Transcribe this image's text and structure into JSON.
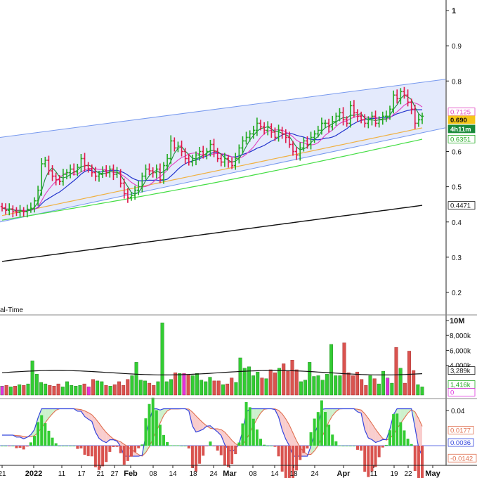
{
  "colors": {
    "up": "#22aa22",
    "down": "#e0184a",
    "volume_up": "#33cc33",
    "volume_down": "#d9534f",
    "volume_magenta": "#e030e0",
    "channel_fill": "#dfe6fb",
    "channel_line": "#7799ee",
    "ma_green": "#1a8a3a",
    "ma_magenta": "#e040c0",
    "ma_blue": "#2233cc",
    "ma_orange": "#f0b040",
    "ma_lightgreen": "#44dd44",
    "ma_black": "#111111",
    "macd_line": "#3344dd",
    "signal_line": "#e07050"
  },
  "chart_data": [
    {
      "type": "candlestick",
      "panel": "price",
      "title": "",
      "y_ticks": [
        "1",
        "0.9",
        "0.8",
        "0.6",
        "0.5",
        "0.4",
        "0.3",
        "0.2"
      ],
      "ylim": [
        0.15,
        1.02
      ],
      "last_close": 0.69,
      "price_tags": [
        {
          "label": "0.7125",
          "value": 0.7125,
          "color": "#e040c0"
        },
        {
          "label": "0.690",
          "value": 0.69,
          "color": "#111111",
          "bg": "#f5c518"
        },
        {
          "label": "4h11m",
          "value": 0.664,
          "color": "#ffffff",
          "bg": "#1a8a3a"
        },
        {
          "label": "0.6351",
          "value": 0.6351,
          "color": "#22aa22"
        },
        {
          "label": "0.4471",
          "value": 0.4471,
          "color": "#111111"
        }
      ],
      "status_text": "al-Time",
      "channel": {
        "upper": [
          0.64,
          0.805
        ],
        "lower": [
          0.4,
          0.667
        ]
      },
      "closes": [
        0.44,
        0.433,
        0.437,
        0.429,
        0.427,
        0.432,
        0.429,
        0.436,
        0.439,
        0.46,
        0.49,
        0.565,
        0.575,
        0.545,
        0.53,
        0.52,
        0.515,
        0.535,
        0.54,
        0.55,
        0.542,
        0.555,
        0.58,
        0.56,
        0.55,
        0.54,
        0.53,
        0.535,
        0.545,
        0.54,
        0.55,
        0.535,
        0.54,
        0.51,
        0.48,
        0.47,
        0.475,
        0.49,
        0.5,
        0.53,
        0.55,
        0.545,
        0.54,
        0.55,
        0.52,
        0.56,
        0.58,
        0.63,
        0.61,
        0.615,
        0.6,
        0.58,
        0.57,
        0.575,
        0.59,
        0.6,
        0.59,
        0.6,
        0.62,
        0.6,
        0.58,
        0.57,
        0.58,
        0.57,
        0.56,
        0.58,
        0.61,
        0.63,
        0.64,
        0.65,
        0.66,
        0.68,
        0.67,
        0.66,
        0.67,
        0.655,
        0.64,
        0.66,
        0.65,
        0.64,
        0.62,
        0.6,
        0.59,
        0.61,
        0.63,
        0.62,
        0.64,
        0.65,
        0.66,
        0.68,
        0.68,
        0.67,
        0.685,
        0.7,
        0.71,
        0.69,
        0.68,
        0.73,
        0.71,
        0.7,
        0.69,
        0.68,
        0.69,
        0.7,
        0.68,
        0.69,
        0.7,
        0.7,
        0.72,
        0.76,
        0.75,
        0.77,
        0.76,
        0.74,
        0.72,
        0.68,
        0.69,
        0.7
      ],
      "ma_values": {
        "last": {
          "ma_magenta": 0.7125,
          "ma_green_light": 0.6351,
          "ma_black": 0.4471
        }
      }
    },
    {
      "type": "bar",
      "panel": "volume",
      "y_ticks": [
        "10M",
        "8,000k",
        "6,000k",
        "4,000k"
      ],
      "ylim": [
        0,
        10000
      ],
      "unit": "k",
      "value_tags": [
        {
          "label": "3,289k",
          "value": 3289,
          "color": "#111111"
        },
        {
          "label": "1,416k",
          "value": 1416,
          "color": "#22aa22"
        },
        {
          "label": "0",
          "value": 0,
          "color": "#e030e0"
        }
      ],
      "values": [
        1200,
        1300,
        1100,
        1200,
        1400,
        1300,
        1500,
        4600,
        2800,
        1700,
        1500,
        1300,
        1200,
        1500,
        1100,
        1800,
        1300,
        1200,
        1300,
        1500,
        1100,
        2100,
        1900,
        1800,
        1300,
        1200,
        1400,
        1800,
        1300,
        2100,
        2600,
        4400,
        2000,
        1900,
        1600,
        1300,
        1800,
        9700,
        1800,
        2100,
        3000,
        2900,
        2900,
        2700,
        2600,
        2900,
        2000,
        1800,
        2400,
        1900,
        1900,
        1400,
        1500,
        2300,
        1700,
        5000,
        3600,
        3800,
        2600,
        3100,
        2300,
        2200,
        3400,
        3000,
        3600,
        4200,
        3200,
        4700,
        3400,
        1800,
        2000,
        4400,
        2500,
        2600,
        2000,
        2800,
        6800,
        2600,
        2600,
        7000,
        3000,
        2600,
        3100,
        2100,
        1300,
        2600,
        2200,
        1500,
        3200,
        2300,
        1600,
        6400,
        3600,
        1600,
        5900,
        3300,
        1400,
        1100
      ]
    },
    {
      "type": "histogram",
      "panel": "macd",
      "y_ticks": [
        "0.04"
      ],
      "ylim": [
        -0.025,
        0.05
      ],
      "value_tags": [
        {
          "label": "0.0177",
          "value": 0.0177,
          "color": "#e07050"
        },
        {
          "label": "0.0036",
          "value": 0.0036,
          "color": "#3344dd"
        },
        {
          "label": "-0.0142",
          "value": -0.0142,
          "color": "#e07050"
        }
      ]
    }
  ],
  "x_axis": {
    "labels": [
      {
        "text": "21",
        "bold": false
      },
      {
        "text": "2022",
        "bold": true
      },
      {
        "text": "11",
        "bold": false
      },
      {
        "text": "17",
        "bold": false
      },
      {
        "text": "21",
        "bold": false
      },
      {
        "text": "27",
        "bold": false
      },
      {
        "text": "Feb",
        "bold": true
      },
      {
        "text": "08",
        "bold": false
      },
      {
        "text": "14",
        "bold": false
      },
      {
        "text": "18",
        "bold": false
      },
      {
        "text": "24",
        "bold": false
      },
      {
        "text": "Mar",
        "bold": true
      },
      {
        "text": "08",
        "bold": false
      },
      {
        "text": "14",
        "bold": false
      },
      {
        "text": "18",
        "bold": false
      },
      {
        "text": "24",
        "bold": false
      },
      {
        "text": "Apr",
        "bold": true
      },
      {
        "text": "11",
        "bold": false
      },
      {
        "text": "19",
        "bold": false
      },
      {
        "text": "22",
        "bold": false
      },
      {
        "text": "May",
        "bold": true
      }
    ]
  }
}
